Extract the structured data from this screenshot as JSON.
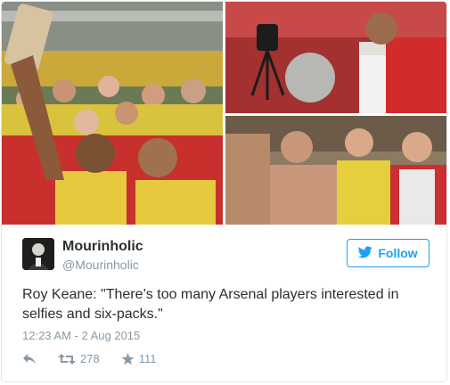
{
  "tweet": {
    "display_name": "Mourinholic",
    "handle": "@Mourinholic",
    "follow_label": "Follow",
    "text": "Roy Keane: \"There’s too many Arsenal players interested in selfies and six-packs.\"",
    "timestamp": "12:23 AM - 2 Aug 2015",
    "retweet_count": "278",
    "like_count": "111"
  },
  "colors": {
    "accent": "#1da1f2",
    "text": "#292f33",
    "muted": "#8899a6",
    "border": "#e1e8ed"
  },
  "icons": {
    "reply": "reply-icon",
    "retweet": "retweet-icon",
    "like": "star-icon",
    "follow": "bird-icon"
  }
}
